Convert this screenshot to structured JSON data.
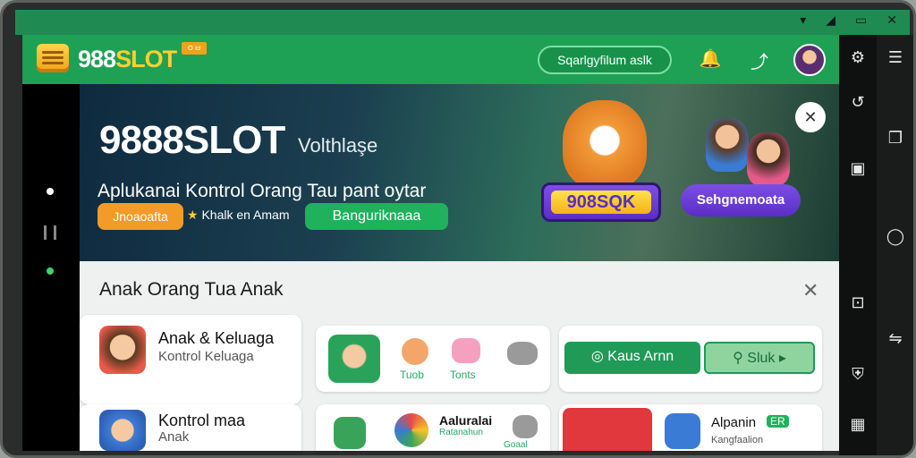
{
  "statusbar": {
    "icons": [
      "wifi-icon",
      "signal-icon",
      "window-icon",
      "close-icon"
    ],
    "glyphs": [
      "▾",
      "◢",
      "▭",
      "✕"
    ]
  },
  "appbar": {
    "logo_main": "988",
    "logo_accent": "SLOT",
    "logo_badge": "ㅇㅂ",
    "search_label": "Sqarlgyfilum aslk",
    "bell_glyph": "🔔",
    "share_glyph": "⤴"
  },
  "hero": {
    "title": "9888SLOT",
    "subtitle": "Volthlaşe",
    "tagline": "Aplukanai Kontrol Orang Tau pant oytar",
    "orange_button": "Jnoaoafta",
    "note_star": "★",
    "note_text": "Khalk en Amam",
    "green_button": "Banguriknaaa",
    "game_badge": "908SQK",
    "family_badge": "Sehgnemoata",
    "close_glyph": "✕"
  },
  "panel": {
    "title": "Anak Orang Tua Anak",
    "close_glyph": "✕",
    "cards": [
      {
        "title": "Anak & Keluaga",
        "sub": "Kontrol Keluaga"
      },
      {
        "title": "Kontrol maa",
        "sub": "Anak"
      }
    ],
    "mini_apps": [
      "Tuob",
      "Tonts"
    ],
    "kids_button": "Kaus Arnn",
    "slot_button": "Sluk",
    "bottom_apps": [
      {
        "title": "Aaluralai",
        "sub": "Ratanahun",
        "extra": "Goaal"
      },
      {
        "title": "Alpanin",
        "badge": "ER",
        "sub": "Kangfaalion"
      }
    ]
  },
  "rails": {
    "right_icons": [
      "gear-icon",
      "menu-icon",
      "share-icon",
      "copy-icon",
      "image-icon",
      "circle-icon",
      "bag-icon",
      "swap-icon",
      "shield-icon",
      "grid-icon"
    ],
    "right_glyphs": [
      "⚙",
      "☰",
      "↺",
      "❐",
      "▣",
      "◯",
      "⊡",
      "⇋",
      "⛨",
      "▦"
    ]
  }
}
